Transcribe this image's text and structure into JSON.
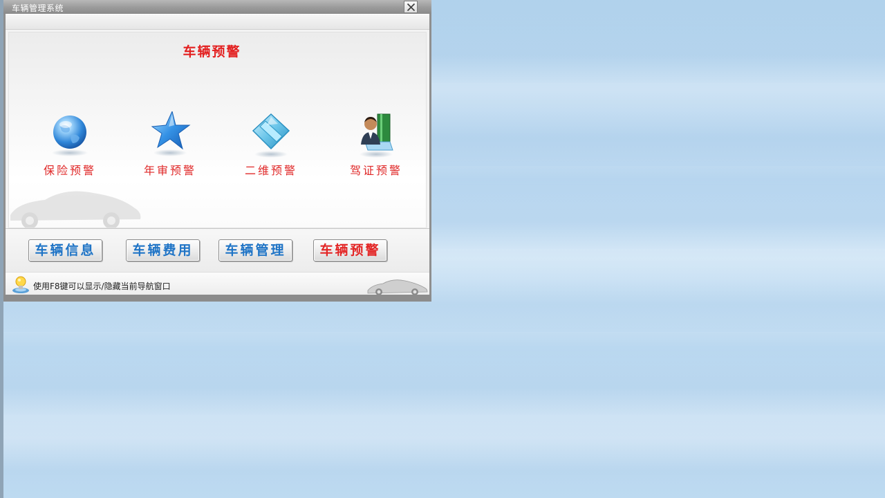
{
  "window": {
    "title": "车辆管理系统"
  },
  "panel": {
    "title": "车辆预警",
    "items": [
      {
        "label": "保险预警",
        "icon": "globe-icon"
      },
      {
        "label": "年审预警",
        "icon": "star-icon"
      },
      {
        "label": "二维预警",
        "icon": "tile-icon"
      },
      {
        "label": "驾证预警",
        "icon": "user-book-icon"
      }
    ]
  },
  "buttons": [
    {
      "label": "车辆信息",
      "active": false
    },
    {
      "label": "车辆费用",
      "active": false
    },
    {
      "label": "车辆管理",
      "active": false
    },
    {
      "label": "车辆预警",
      "active": true
    }
  ],
  "status": {
    "hint": "使用F8键可以显示/隐藏当前导航窗口"
  },
  "colors": {
    "accent_red": "#e32020",
    "accent_blue": "#1f74c6",
    "desktop": "#b9d8f0"
  }
}
